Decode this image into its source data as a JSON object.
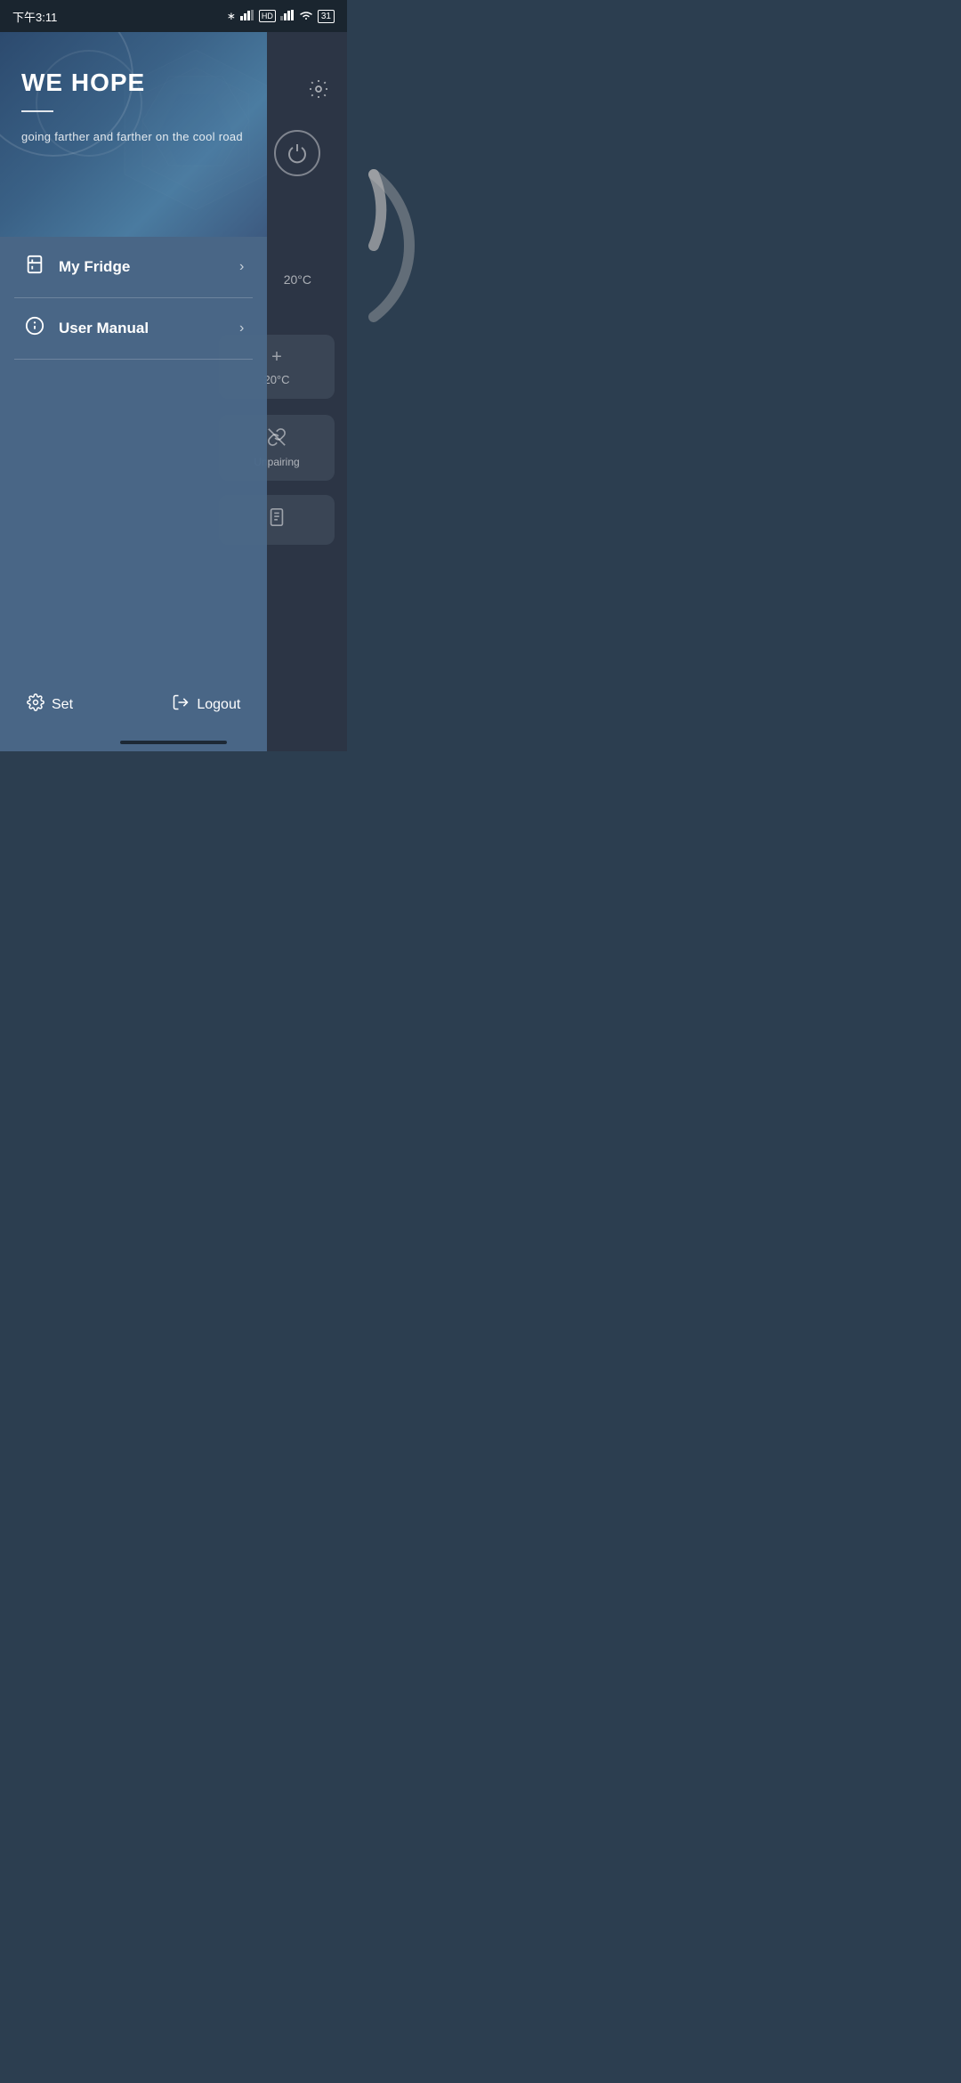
{
  "statusBar": {
    "time": "下午3:11",
    "batteryLevel": "31"
  },
  "hero": {
    "title": "WE HOPE",
    "subtitle": "going farther and farther on the cool road"
  },
  "menu": {
    "items": [
      {
        "id": "my-fridge",
        "icon": "fridge",
        "label": "My Fridge"
      },
      {
        "id": "user-manual",
        "icon": "info",
        "label": "User Manual"
      }
    ]
  },
  "footer": {
    "setLabel": "Set",
    "logoutLabel": "Logout"
  },
  "rightPanel": {
    "tempDial": "20°C",
    "tempDisplay": "20°C",
    "unpairingLabel": "Unpairing"
  }
}
